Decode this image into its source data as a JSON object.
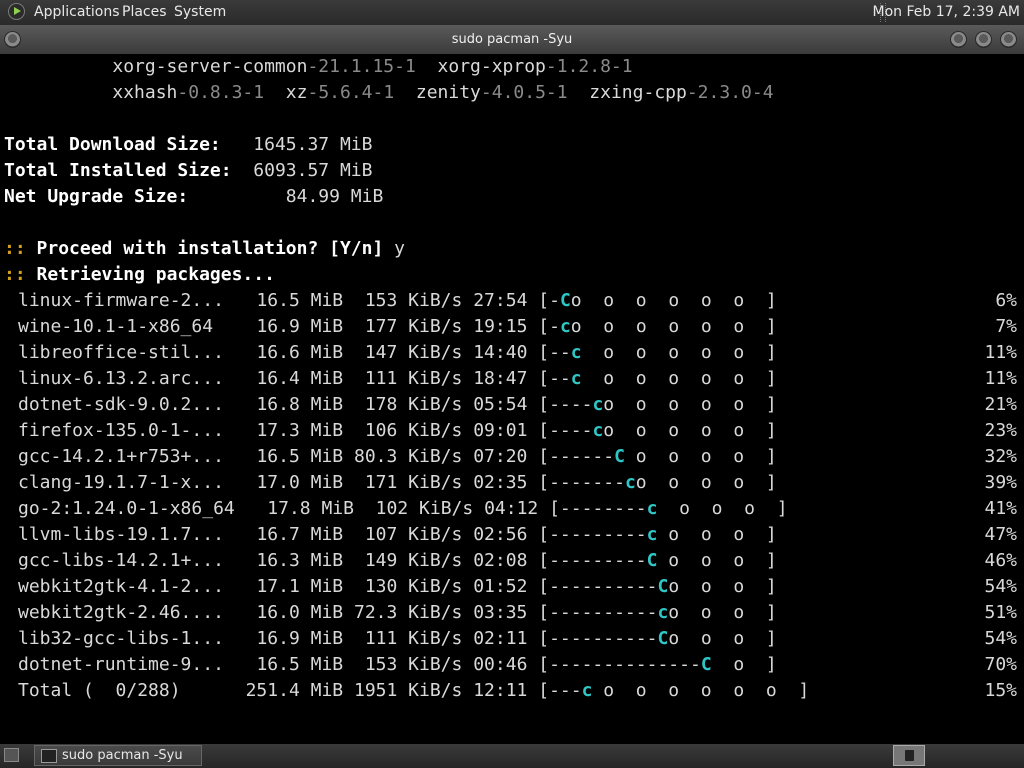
{
  "top_panel": {
    "menus": [
      "Applications",
      "Places",
      "System"
    ],
    "clock": "Mon Feb 17,  2:39 AM"
  },
  "window": {
    "title": "sudo pacman -Syu"
  },
  "terminal": {
    "pkg_line_1": [
      {
        "name": "xorg-server-common",
        "ver": "-21.1.15-1"
      },
      {
        "name": "xorg-xprop",
        "ver": "-1.2.8-1"
      }
    ],
    "pkg_line_2": [
      {
        "name": "xxhash",
        "ver": "-0.8.3-1"
      },
      {
        "name": "xz",
        "ver": "-5.6.4-1"
      },
      {
        "name": "zenity",
        "ver": "-4.0.5-1"
      },
      {
        "name": "zxing-cpp",
        "ver": "-2.3.0-4"
      }
    ],
    "sizes": [
      {
        "label": "Total Download Size:",
        "value": "1645.37 MiB"
      },
      {
        "label": "Total Installed Size:",
        "value": "6093.57 MiB"
      },
      {
        "label": "Net Upgrade Size:",
        "value": "84.99 MiB"
      }
    ],
    "proceed": {
      "prefix": "::",
      "question": "Proceed with installation? [Y/n]",
      "answer": "y"
    },
    "retrieving": {
      "prefix": "::",
      "text": "Retrieving packages..."
    },
    "downloads": [
      {
        "name": "linux-firmware-2...",
        "size": "16.5 MiB",
        "rate": "153 KiB/s",
        "eta": "27:54",
        "pre": "[-",
        "pac": "C",
        "post": "o  o  o  o  o  o  ]",
        "pct": "6%"
      },
      {
        "name": "wine-10.1-1-x86_64",
        "size": "16.9 MiB",
        "rate": "177 KiB/s",
        "eta": "19:15",
        "pre": "[-",
        "pac": "c",
        "post": "o  o  o  o  o  o  ]",
        "pct": "7%"
      },
      {
        "name": "libreoffice-stil...",
        "size": "16.6 MiB",
        "rate": "147 KiB/s",
        "eta": "14:40",
        "pre": "[--",
        "pac": "c",
        "post": "  o  o  o  o  o  ]",
        "pct": "11%"
      },
      {
        "name": "linux-6.13.2.arc...",
        "size": "16.4 MiB",
        "rate": "111 KiB/s",
        "eta": "18:47",
        "pre": "[--",
        "pac": "c",
        "post": "  o  o  o  o  o  ]",
        "pct": "11%"
      },
      {
        "name": "dotnet-sdk-9.0.2...",
        "size": "16.8 MiB",
        "rate": "178 KiB/s",
        "eta": "05:54",
        "pre": "[----",
        "pac": "c",
        "post": "o  o  o  o  o  ]",
        "pct": "21%"
      },
      {
        "name": "firefox-135.0-1-...",
        "size": "17.3 MiB",
        "rate": "106 KiB/s",
        "eta": "09:01",
        "pre": "[----",
        "pac": "c",
        "post": "o  o  o  o  o  ]",
        "pct": "23%"
      },
      {
        "name": "gcc-14.2.1+r753+...",
        "size": "16.5 MiB",
        "rate": "80.3 KiB/s",
        "eta": "07:20",
        "pre": "[------",
        "pac": "C",
        "post": " o  o  o  o  ]",
        "pct": "32%"
      },
      {
        "name": "clang-19.1.7-1-x...",
        "size": "17.0 MiB",
        "rate": "171 KiB/s",
        "eta": "02:35",
        "pre": "[-------",
        "pac": "c",
        "post": "o  o  o  o  ]",
        "pct": "39%"
      },
      {
        "name": "go-2:1.24.0-1-x86_64",
        "size": "17.8 MiB",
        "rate": "102 KiB/s",
        "eta": "04:12",
        "pre": "[--------",
        "pac": "c",
        "post": "  o  o  o  ]",
        "pct": "41%"
      },
      {
        "name": "llvm-libs-19.1.7...",
        "size": "16.7 MiB",
        "rate": "107 KiB/s",
        "eta": "02:56",
        "pre": "[---------",
        "pac": "c",
        "post": " o  o  o  ]",
        "pct": "47%"
      },
      {
        "name": "gcc-libs-14.2.1+...",
        "size": "16.3 MiB",
        "rate": "149 KiB/s",
        "eta": "02:08",
        "pre": "[---------",
        "pac": "C",
        "post": " o  o  o  ]",
        "pct": "46%"
      },
      {
        "name": "webkit2gtk-4.1-2...",
        "size": "17.1 MiB",
        "rate": "130 KiB/s",
        "eta": "01:52",
        "pre": "[----------",
        "pac": "C",
        "post": "o  o  o  ]",
        "pct": "54%"
      },
      {
        "name": "webkit2gtk-2.46....",
        "size": "16.0 MiB",
        "rate": "72.3 KiB/s",
        "eta": "03:35",
        "pre": "[----------",
        "pac": "c",
        "post": "o  o  o  ]",
        "pct": "51%"
      },
      {
        "name": "lib32-gcc-libs-1...",
        "size": "16.9 MiB",
        "rate": "111 KiB/s",
        "eta": "02:11",
        "pre": "[----------",
        "pac": "C",
        "post": "o  o  o  ]",
        "pct": "54%"
      },
      {
        "name": "dotnet-runtime-9...",
        "size": "16.5 MiB",
        "rate": "153 KiB/s",
        "eta": "00:46",
        "pre": "[--------------",
        "pac": "C",
        "post": "  o  ]",
        "pct": "70%"
      },
      {
        "name": "Total (  0/288)",
        "size": "251.4 MiB",
        "rate": "1951 KiB/s",
        "eta": "12:11",
        "pre": "[---",
        "pac": "c",
        "post": " o  o  o  o  o  o  ]",
        "pct": "15%"
      }
    ]
  },
  "taskbar": {
    "task_label": "sudo pacman -Syu"
  },
  "colors": {
    "terminal_bg": "#000000",
    "text": "#d9d9d9",
    "version_text": "#8a8a8a",
    "prompt_prefix": "#d4a017",
    "pacman": "#2fc6c6"
  }
}
